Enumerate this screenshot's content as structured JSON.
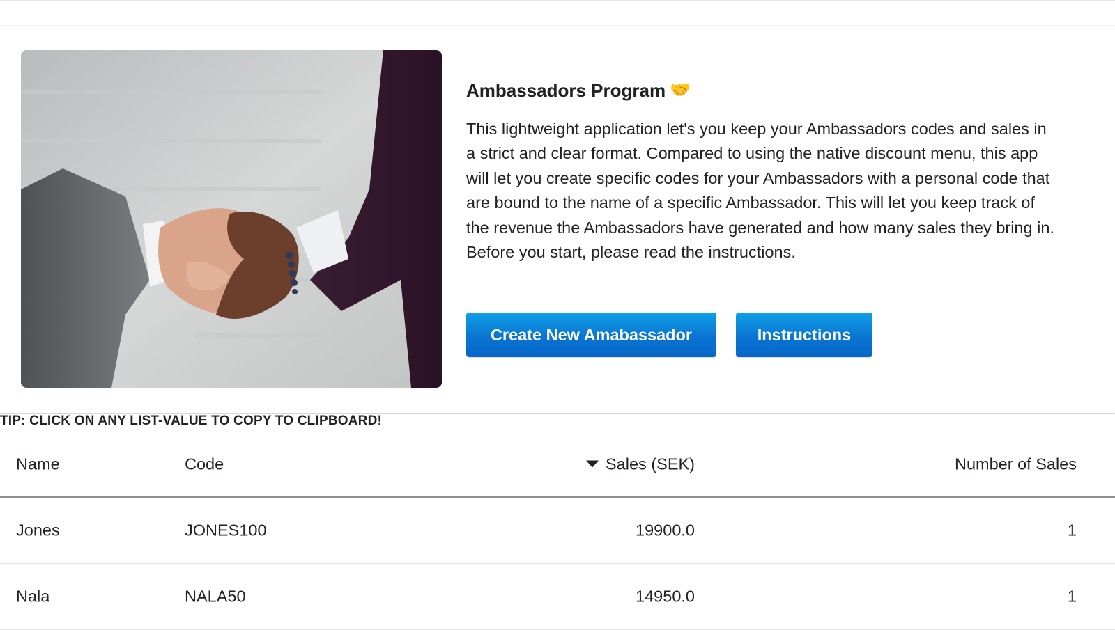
{
  "card": {
    "title": "Ambassadors Program",
    "title_icon": "handshake-icon",
    "description": "This lightweight application let's you keep your Ambassadors codes and sales in a strict and clear format. Compared to using the native discount menu, this app will let you create specific codes for your Ambassadors with a personal code that are bound to the name of a specific Ambassador. This will let you keep track of the revenue the Ambassadors have generated and how many sales they bring in. Before you start, please read the instructions.",
    "buttons": {
      "create_label": "Create New Amabassador",
      "instructions_label": "Instructions"
    },
    "image": "handshake-photo",
    "accent_color": "#0a74d1"
  },
  "tip": "TIP: CLICK ON ANY LIST-VALUE TO COPY TO CLIPBOARD!",
  "table": {
    "columns": [
      "Name",
      "Code",
      "Sales (SEK)",
      "Number of Sales"
    ],
    "sorted_column": "Sales (SEK)",
    "sort_direction": "descending",
    "rows": [
      [
        "Jones",
        "JONES100",
        "19900.0",
        "1"
      ],
      [
        "Nala",
        "NALA50",
        "14950.0",
        "1"
      ]
    ]
  }
}
